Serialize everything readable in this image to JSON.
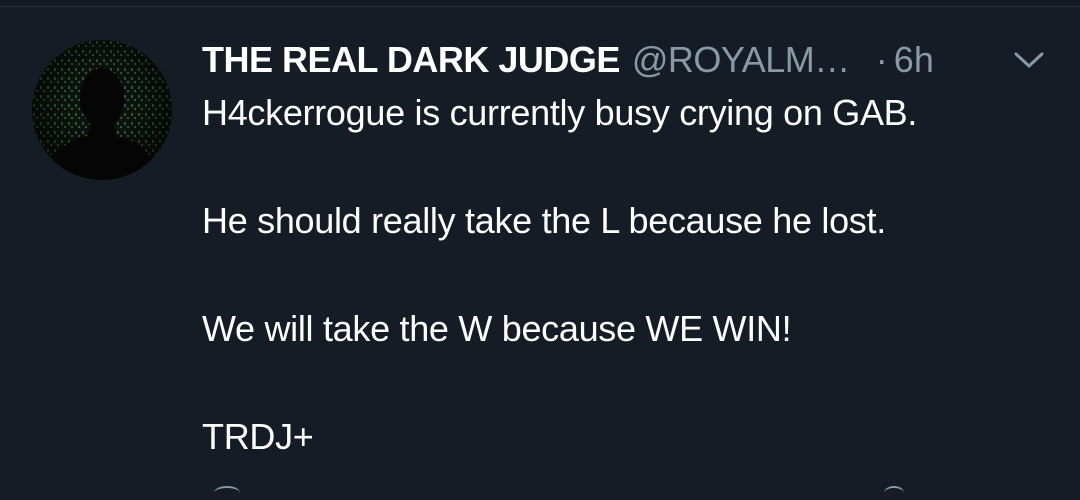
{
  "tweet": {
    "display_name": "THE REAL DARK JUDGE",
    "handle": "@ROYALM…",
    "separator": "·",
    "time": "6h",
    "lines": [
      "H4ckerrogue is currently busy crying on GAB.",
      "He should really take the L because he lost.",
      "We will take the W because WE WIN!",
      "TRDJ+"
    ]
  },
  "colors": {
    "background": "#151c25",
    "text": "#ffffff",
    "secondary": "#8899a6",
    "avatar_matrix": "#2f6b3a"
  },
  "icons": {
    "menu": "chevron-down-icon",
    "avatar": "silhouette-avatar"
  }
}
